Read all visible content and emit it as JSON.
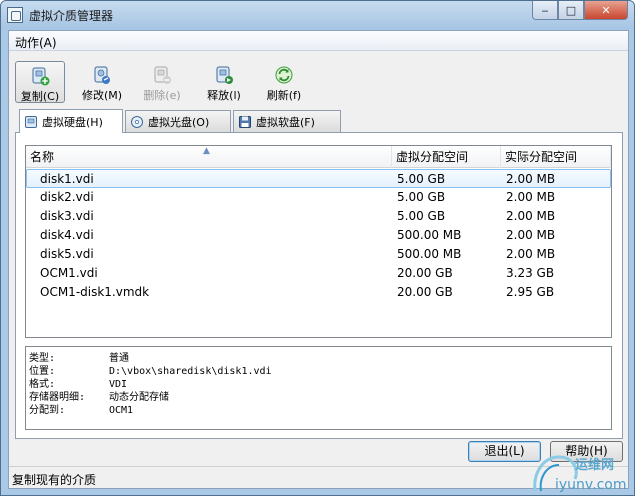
{
  "window": {
    "title": "虚拟介质管理器"
  },
  "menu": {
    "action": "动作(A)"
  },
  "toolbar": {
    "items": [
      {
        "label": "复制(C)",
        "icon": "copy-disk-icon",
        "enabled": true
      },
      {
        "label": "修改(M)",
        "icon": "modify-disk-icon",
        "enabled": true
      },
      {
        "label": "删除(e)",
        "icon": "delete-disk-icon",
        "enabled": false
      },
      {
        "label": "释放(l)",
        "icon": "release-disk-icon",
        "enabled": true
      },
      {
        "label": "刷新(f)",
        "icon": "refresh-icon",
        "enabled": true
      }
    ]
  },
  "tabs": [
    {
      "label": "虚拟硬盘(H)",
      "icon": "hard-disk-icon",
      "selected": true
    },
    {
      "label": "虚拟光盘(O)",
      "icon": "optical-disk-icon",
      "selected": false
    },
    {
      "label": "虚拟软盘(F)",
      "icon": "floppy-disk-icon",
      "selected": false
    }
  ],
  "table": {
    "columns": [
      "名称",
      "虚拟分配空间",
      "实际分配空间"
    ],
    "rows": [
      {
        "name": "disk1.vdi",
        "virtual": "5.00 GB",
        "actual": "2.00 MB",
        "selected": true
      },
      {
        "name": "disk2.vdi",
        "virtual": "5.00 GB",
        "actual": "2.00 MB"
      },
      {
        "name": "disk3.vdi",
        "virtual": "5.00 GB",
        "actual": "2.00 MB"
      },
      {
        "name": "disk4.vdi",
        "virtual": "500.00 MB",
        "actual": "2.00 MB"
      },
      {
        "name": "disk5.vdi",
        "virtual": "500.00 MB",
        "actual": "2.00 MB"
      },
      {
        "name": "OCM1.vdi",
        "virtual": "20.00 GB",
        "actual": "3.23 GB"
      },
      {
        "name": "OCM1-disk1.vmdk",
        "virtual": "20.00 GB",
        "actual": "2.95 GB"
      }
    ]
  },
  "details": [
    {
      "label": "类型:",
      "value": "普通"
    },
    {
      "label": "位置:",
      "value": "D:\\vbox\\sharedisk\\disk1.vdi"
    },
    {
      "label": "格式:",
      "value": "VDI"
    },
    {
      "label": "存储器明细:",
      "value": "动态分配存储"
    },
    {
      "label": "分配到:",
      "value": "OCM1"
    }
  ],
  "buttons": {
    "exit": "退出(L)",
    "help": "帮助(H)"
  },
  "status": {
    "text": "复制现有的介质"
  },
  "watermark": {
    "line1": "运维网",
    "line2": "iyunv.com"
  },
  "colors": {
    "accent": "#3c7fb1",
    "selection": "#e5f1fd",
    "title_bar": "#a6c4e3"
  }
}
